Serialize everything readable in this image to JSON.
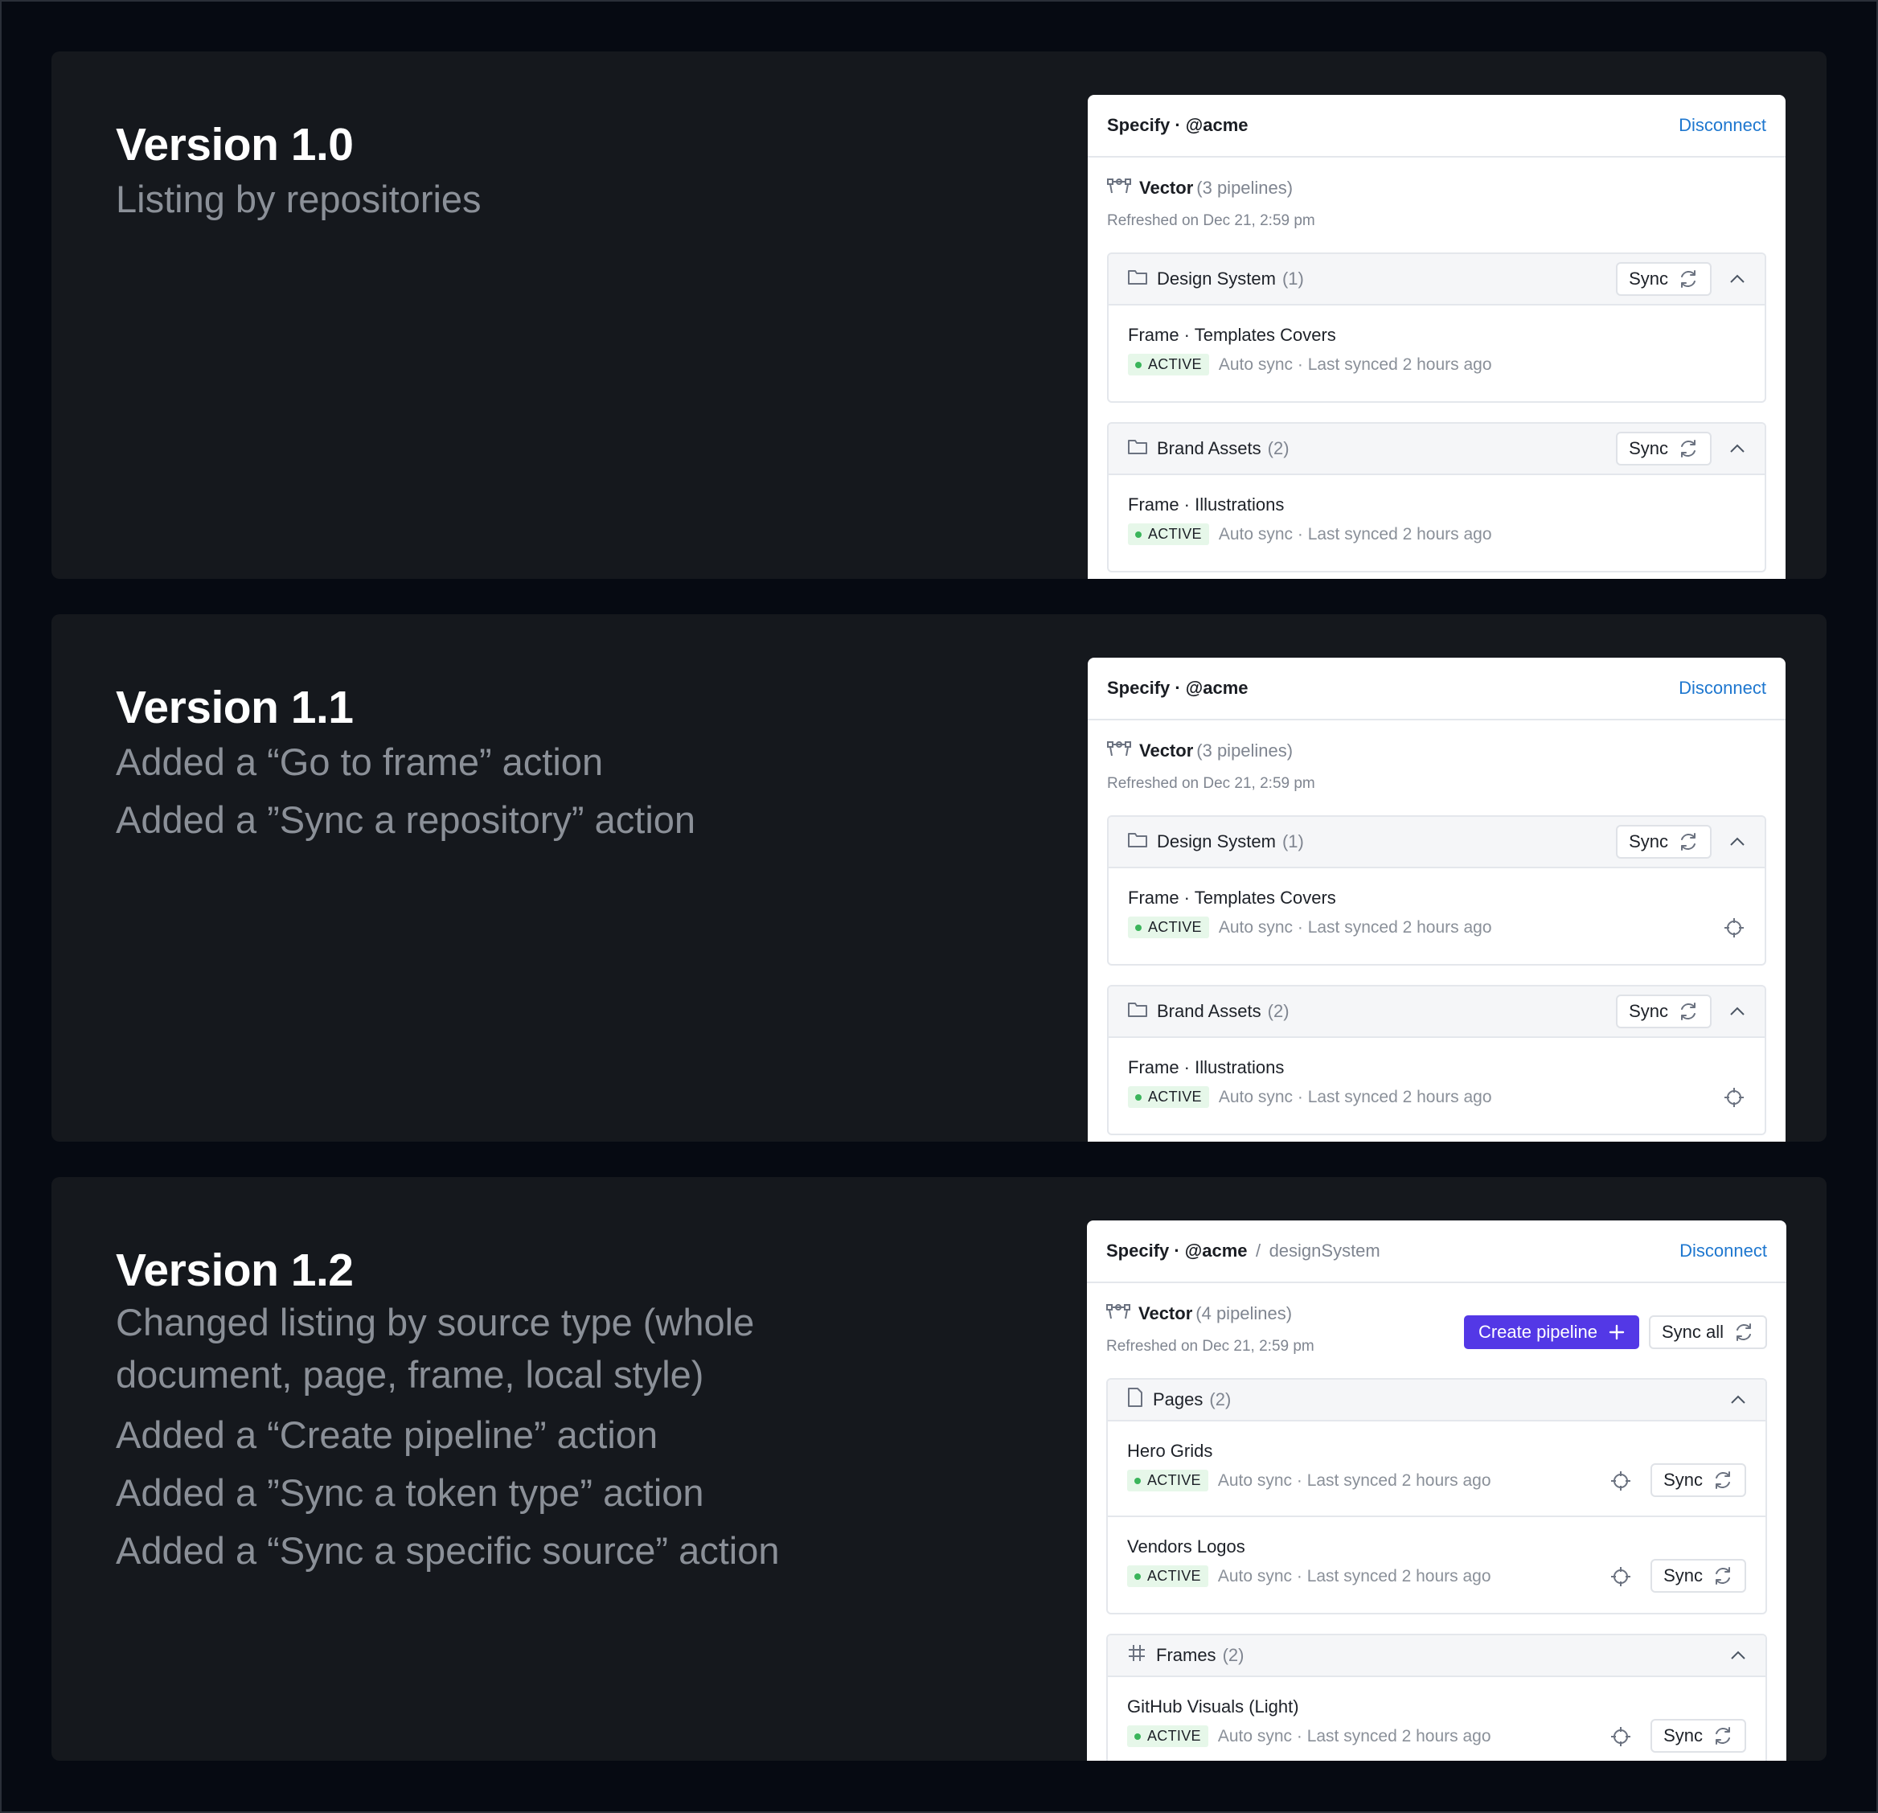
{
  "sections": [
    {
      "title": "Version 1.0",
      "lines": [
        "Listing by repositories"
      ],
      "panel": {
        "brand": "Specify · @acme",
        "disconnect": "Disconnect",
        "vector_name": "Vector",
        "vector_count": "(3 pipelines)",
        "refreshed": "Refreshed on Dec 21, 2:59 pm",
        "groups": [
          {
            "name": "Design System",
            "count": "(1)",
            "sync": "Sync",
            "items": [
              {
                "title": "Frame · Templates Covers",
                "status": "ACTIVE",
                "meta": "Auto sync · Last synced 2 hours ago"
              }
            ]
          },
          {
            "name": "Brand Assets",
            "count": "(2)",
            "sync": "Sync",
            "items": [
              {
                "title": "Frame · Illustrations",
                "status": "ACTIVE",
                "meta": "Auto sync · Last synced 2 hours ago"
              }
            ]
          }
        ]
      }
    },
    {
      "title": "Version 1.1",
      "lines": [
        "Added a “Go to frame” action",
        "Added a ”Sync a repository” action"
      ],
      "panel": {
        "brand": "Specify · @acme",
        "disconnect": "Disconnect",
        "vector_name": "Vector",
        "vector_count": "(3 pipelines)",
        "refreshed": "Refreshed on Dec 21, 2:59 pm",
        "groups": [
          {
            "name": "Design System",
            "count": "(1)",
            "sync": "Sync",
            "items": [
              {
                "title": "Frame · Templates Covers",
                "status": "ACTIVE",
                "meta": "Auto sync · Last synced 2 hours ago"
              }
            ]
          },
          {
            "name": "Brand Assets",
            "count": "(2)",
            "sync": "Sync",
            "items": [
              {
                "title": "Frame · Illustrations",
                "status": "ACTIVE",
                "meta": "Auto sync · Last synced 2 hours ago"
              }
            ]
          }
        ]
      }
    },
    {
      "title": "Version 1.2",
      "lines": [
        "Changed listing by source type (whole document, page, frame, local style)",
        "Added a “Create pipeline” action",
        "Added a ”Sync a token type” action",
        "Added a “Sync a specific source” action"
      ],
      "panel": {
        "brand": "Specify · @acme",
        "crumb_sep": "/",
        "crumb": "designSystem",
        "disconnect": "Disconnect",
        "vector_name": "Vector",
        "vector_count": "(4 pipelines)",
        "refreshed": "Refreshed on Dec 21, 2:59 pm",
        "create_pipeline": "Create pipeline",
        "sync_all": "Sync all",
        "groups": [
          {
            "name": "Pages",
            "count": "(2)",
            "items": [
              {
                "title": "Hero Grids",
                "status": "ACTIVE",
                "meta": "Auto sync · Last synced 2 hours ago",
                "sync": "Sync"
              },
              {
                "title": "Vendors Logos",
                "status": "ACTIVE",
                "meta": "Auto sync · Last synced 2 hours ago",
                "sync": "Sync"
              }
            ]
          },
          {
            "name": "Frames",
            "count": "(2)",
            "items": [
              {
                "title": "GitHub Visuals (Light)",
                "status": "ACTIVE",
                "meta": "Auto sync · Last synced 2 hours ago",
                "sync": "Sync"
              }
            ]
          }
        ]
      }
    }
  ]
}
